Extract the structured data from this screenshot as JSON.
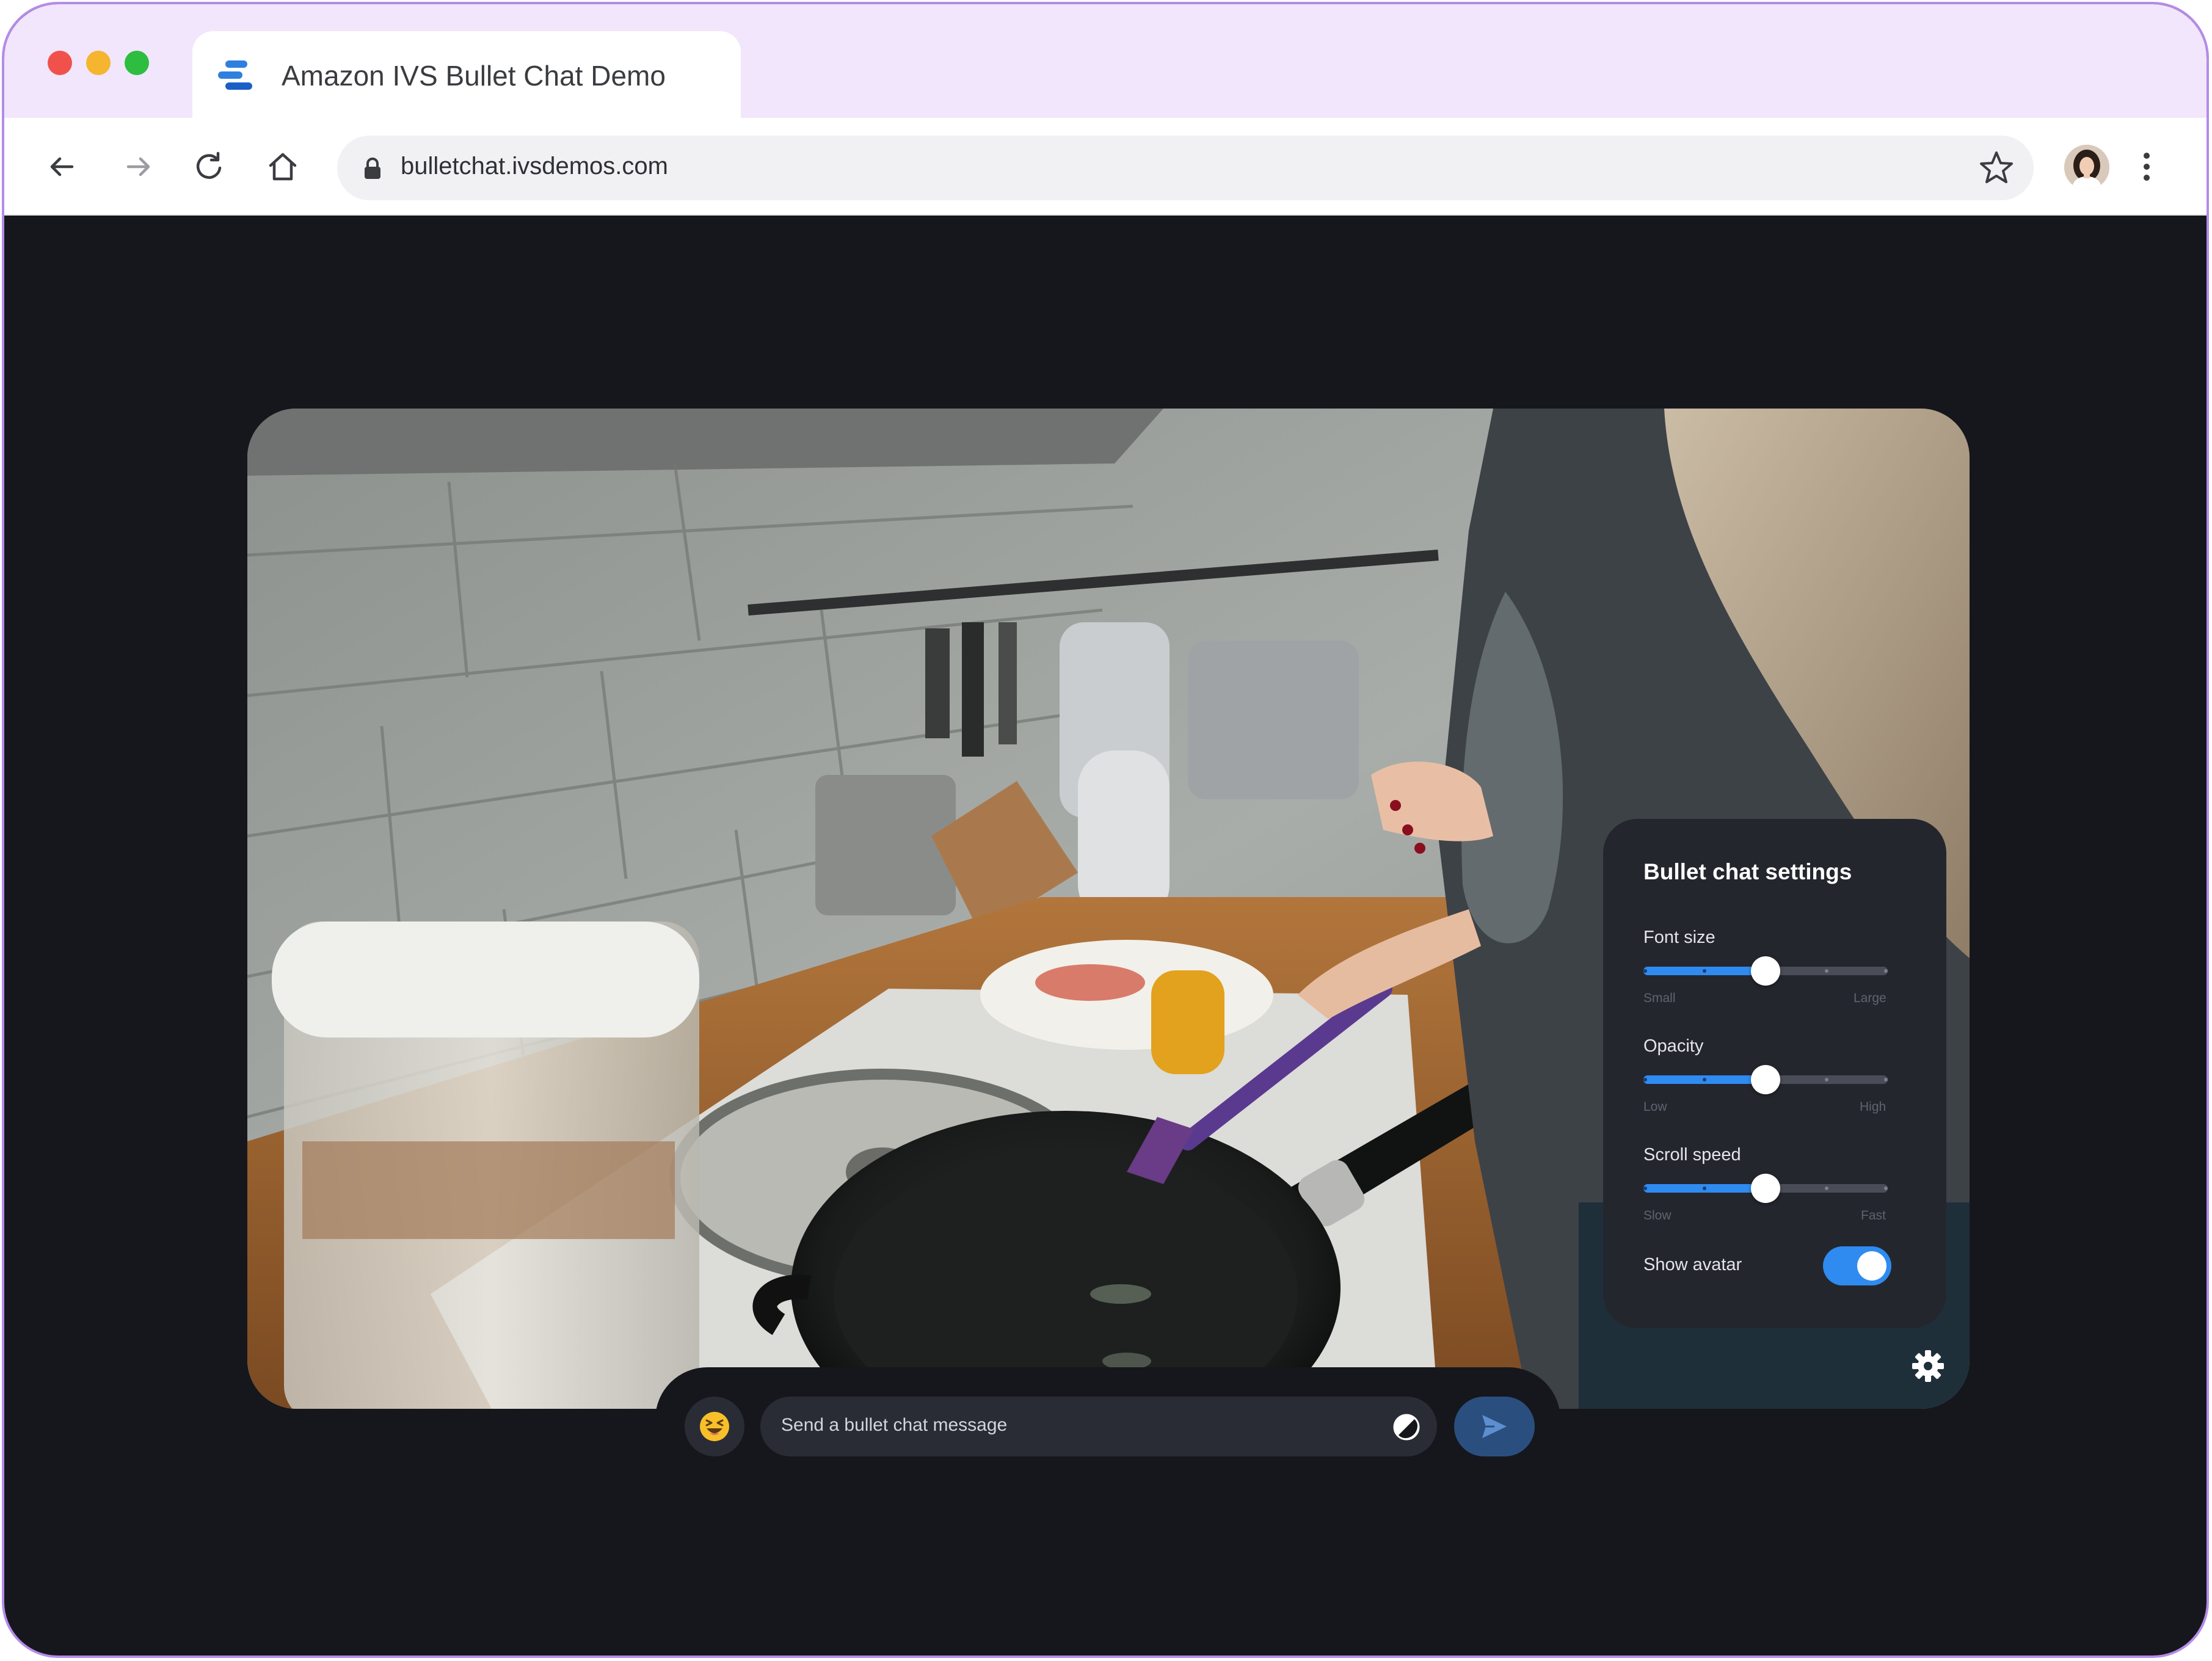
{
  "browser": {
    "tab_title": "Amazon IVS Bullet Chat Demo",
    "url": "bulletchat.ivsdemos.com",
    "icons": [
      "back-icon",
      "forward-icon",
      "reload-icon",
      "home-icon",
      "lock-icon",
      "bookmark-star-icon",
      "profile-avatar",
      "menu-kebab-icon"
    ]
  },
  "settings": {
    "title": "Bullet chat settings",
    "font_size": {
      "label": "Font size",
      "min_label": "Small",
      "max_label": "Large",
      "value": 0.5
    },
    "opacity": {
      "label": "Opacity",
      "min_label": "Low",
      "max_label": "High",
      "value": 0.5
    },
    "scroll_speed": {
      "label": "Scroll speed",
      "min_label": "Slow",
      "max_label": "Fast",
      "value": 0.5
    },
    "show_avatar": {
      "label": "Show avatar",
      "enabled": true
    }
  },
  "chat": {
    "placeholder": "Send a bullet chat message",
    "emoji_icon": "grinning-squint-emoji-icon",
    "contrast_icon": "contrast-icon",
    "send_icon": "send-icon",
    "settings_icon": "gear-icon"
  },
  "colors": {
    "accent": "#2f8bf0",
    "page_background": "#16171c",
    "panel_background": "#24262e",
    "titlebar_background": "#f1e6fb"
  }
}
